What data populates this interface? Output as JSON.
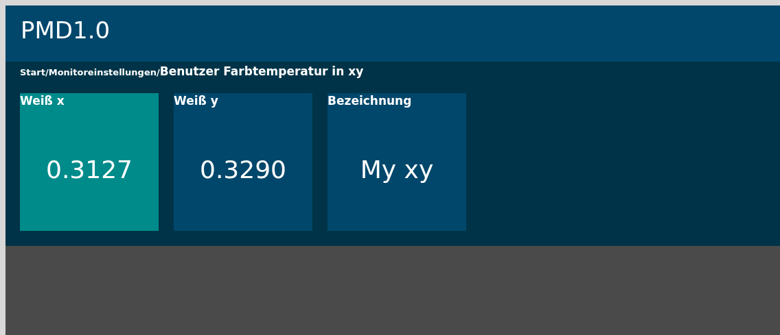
{
  "header": {
    "title": "PMD1.0"
  },
  "breadcrumb": {
    "path": "Start/Monitoreinstellungen/",
    "current": "Benutzer Farbtemperatur in xy"
  },
  "tiles": [
    {
      "label": "Weiß x",
      "value": "0.3127",
      "selected": true
    },
    {
      "label": "Weiß y",
      "value": "0.3290",
      "selected": false
    },
    {
      "label": "Bezeichnung",
      "value": "My xy",
      "selected": false
    }
  ]
}
